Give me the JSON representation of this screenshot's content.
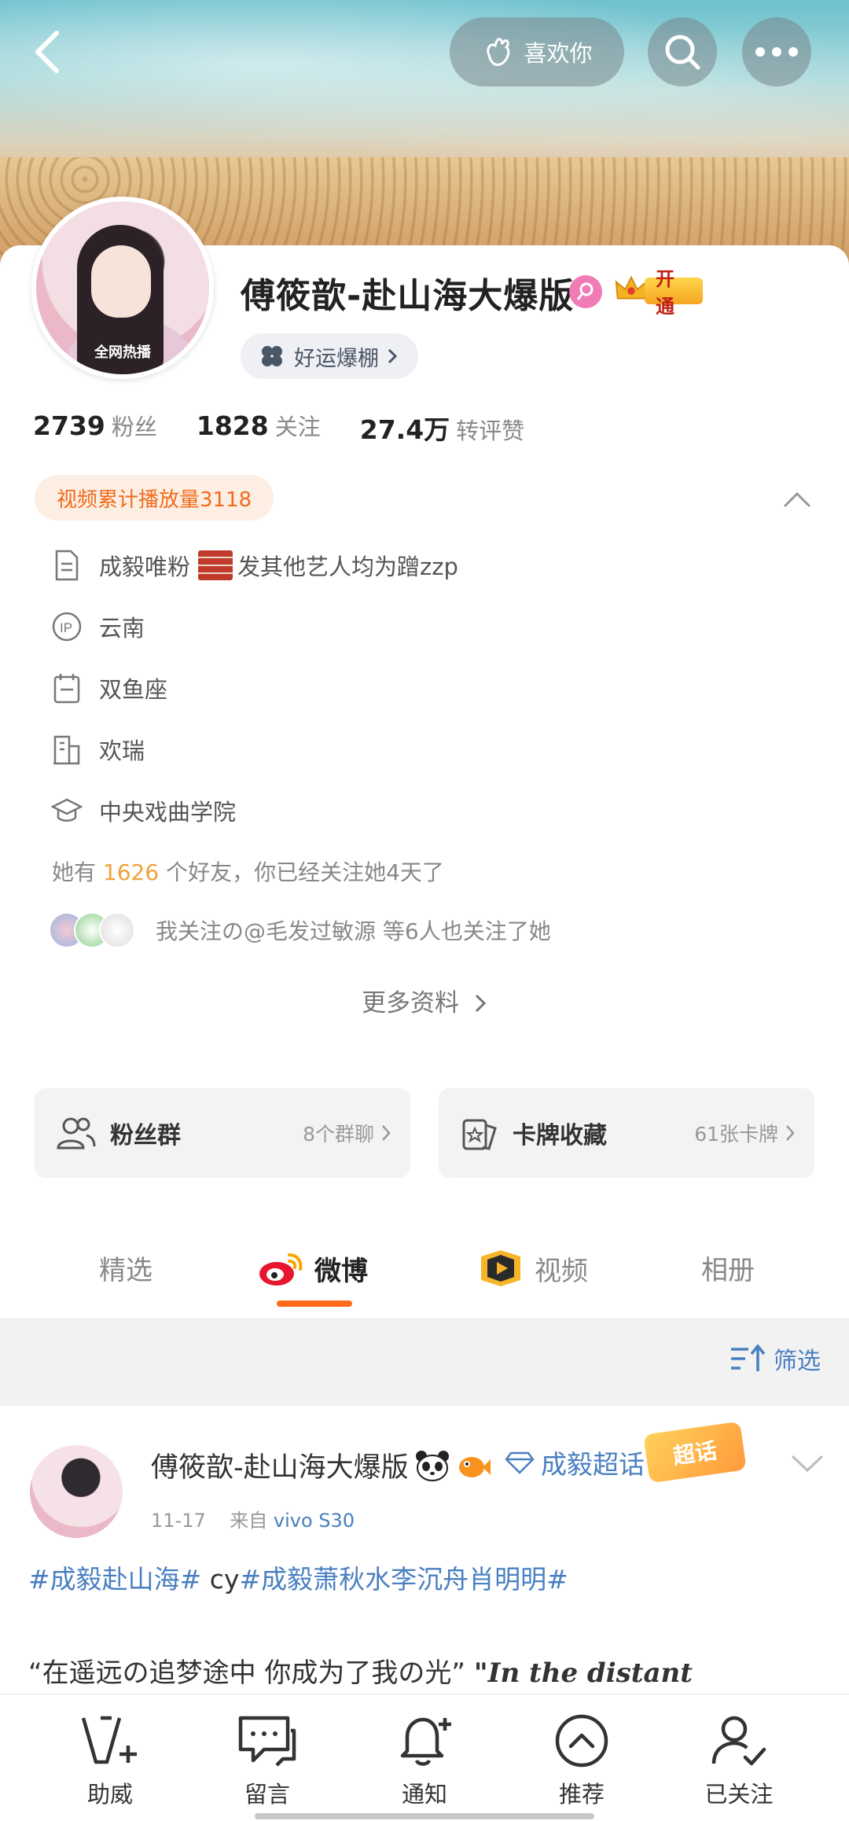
{
  "header": {
    "like_label": "喜欢你"
  },
  "profile": {
    "name": "傅筱歆-赴山海大爆版",
    "vip_label": "开通",
    "luck_label": "好运爆棚",
    "avatar_caption": "全网热播"
  },
  "stats": [
    {
      "num": "2739",
      "label": "粉丝"
    },
    {
      "num": "1828",
      "label": "关注"
    },
    {
      "num": "27.4万",
      "label": "转评赞"
    }
  ],
  "video_tag": "视频累计播放量3118",
  "info": {
    "bio_prefix": "成毅唯粉",
    "bio_suffix": "发其他艺人均为蹭zzp",
    "location": "云南",
    "zodiac": "双鱼座",
    "company": "欢瑞",
    "school": "中央戏曲学院"
  },
  "friends": {
    "prefix": "她有",
    "count": "1626",
    "suffix": "个好友，你已经关注她4天了"
  },
  "mutual_text": "我关注の@毛发过敏源 等6人也关注了她",
  "more_info": "更多资料",
  "cards": {
    "fans_group": {
      "title": "粉丝群",
      "sub": "8个群聊"
    },
    "card_collect": {
      "title": "卡牌收藏",
      "sub": "61张卡牌"
    }
  },
  "tabs": [
    "精选",
    "微博",
    "视频",
    "相册"
  ],
  "filter_label": "筛选",
  "post": {
    "name": "傅筱歆-赴山海大爆版",
    "topic": "成毅超话",
    "chaohua_badge": "超话",
    "date": "11-17",
    "source_prefix": "来自",
    "source": "vivo S30",
    "tag1": "#成毅赴山海#",
    "mid": " cy",
    "tag2": "#成毅萧秋水李沉舟肖明明#",
    "text_cn": "“在遥远の追梦途中 你成为了我の光”",
    "text_en": "\"In the distant"
  },
  "bottom_nav": [
    "助威",
    "留言",
    "通知",
    "推荐",
    "已关注"
  ],
  "colors": {
    "accent_orange": "#ff6a1a",
    "link_blue": "#4a7fc1",
    "friend_count": "#f0a13a"
  }
}
